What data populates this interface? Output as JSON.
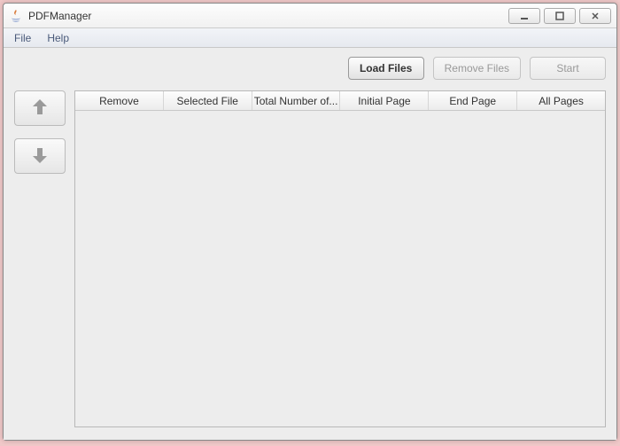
{
  "window": {
    "title": "PDFManager"
  },
  "menubar": {
    "file": "File",
    "help": "Help"
  },
  "toolbar": {
    "load_label": "Load Files",
    "remove_label": "Remove Files",
    "start_label": "Start"
  },
  "table": {
    "columns": {
      "remove": "Remove",
      "selected_file": "Selected File",
      "total_pages": "Total Number of...",
      "initial_page": "Initial Page",
      "end_page": "End Page",
      "all_pages": "All Pages"
    },
    "rows": []
  }
}
